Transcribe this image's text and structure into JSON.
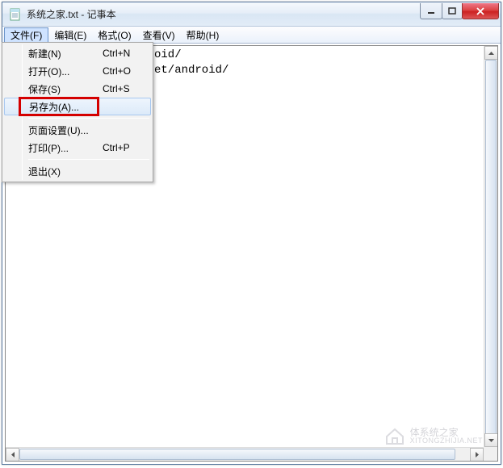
{
  "title": "系统之家.txt - 记事本",
  "menubar": [
    "文件(F)",
    "编辑(E)",
    "格式(O)",
    "查看(V)",
    "帮助(H)"
  ],
  "dropdown": {
    "items": [
      {
        "label": "新建(N)",
        "accel": "Ctrl+N"
      },
      {
        "label": "打开(O)...",
        "accel": "Ctrl+O"
      },
      {
        "label": "保存(S)",
        "accel": "Ctrl+S"
      },
      {
        "label": "另存为(A)...",
        "accel": ""
      },
      {
        "label": "页面设置(U)...",
        "accel": ""
      },
      {
        "label": "打印(P)...",
        "accel": "Ctrl+P"
      },
      {
        "label": "退出(X)",
        "accel": ""
      }
    ]
  },
  "editor_lines": [
    "oid/",
    "et/android/"
  ],
  "watermark": {
    "brand": "体系统之家",
    "url": "XITONGZHIJIA.NET"
  },
  "colors": {
    "highlight": "#d40000",
    "titlebar_border": "#5a7aa0"
  }
}
